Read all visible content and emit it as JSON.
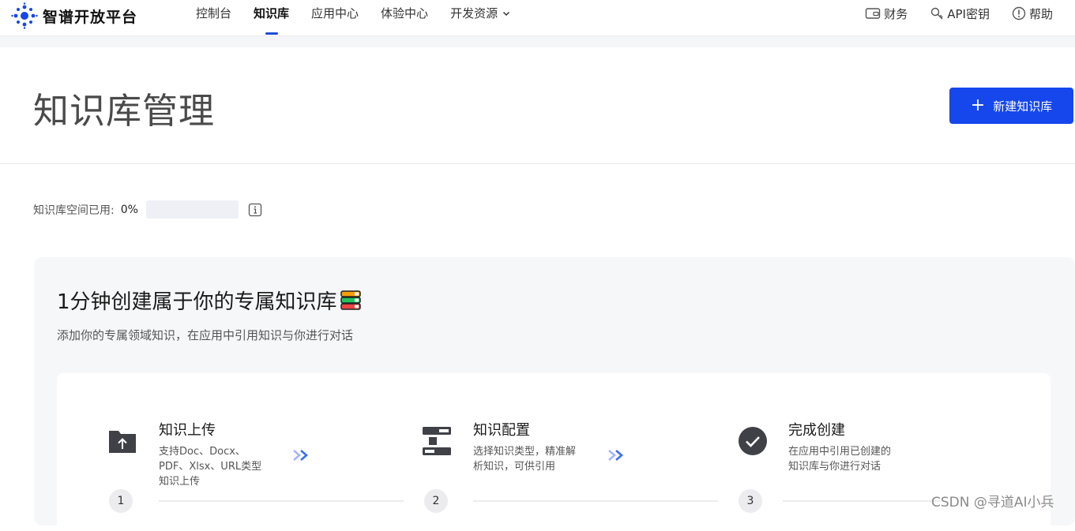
{
  "app": {
    "name": "智谱开放平台"
  },
  "nav": {
    "items": [
      {
        "label": "控制台",
        "active": false
      },
      {
        "label": "知识库",
        "active": true
      },
      {
        "label": "应用中心",
        "active": false
      },
      {
        "label": "体验中心",
        "active": false
      },
      {
        "label": "开发资源",
        "active": false,
        "has_dropdown": true
      }
    ],
    "right": [
      {
        "label": "财务",
        "icon": "wallet-icon"
      },
      {
        "label": "API密钥",
        "icon": "key-icon"
      },
      {
        "label": "帮助",
        "icon": "help-icon"
      }
    ]
  },
  "page": {
    "title": "知识库管理",
    "new_button_label": "新建知识库"
  },
  "usage": {
    "label": "知识库空间已用:",
    "value": "0%",
    "percent": 0
  },
  "intro": {
    "title": "1分钟创建属于你的专属知识库",
    "subtitle": "添加你的专属领域知识，在应用中引用知识与你进行对话",
    "steps": [
      {
        "number": "1",
        "title": "知识上传",
        "desc": "支持Doc、Docx、PDF、Xlsx、URL类型知识上传",
        "icon": "folder-upload-icon"
      },
      {
        "number": "2",
        "title": "知识配置",
        "desc": "选择知识类型，精准解析知识，可供引用",
        "icon": "config-icon"
      },
      {
        "number": "3",
        "title": "完成创建",
        "desc": "在应用中引用已创建的知识库与你进行对话",
        "icon": "check-circle-icon"
      }
    ]
  },
  "watermark": "CSDN @寻道AI小兵",
  "colors": {
    "primary": "#1547ed",
    "nav_active_underline": "#1d4ed8"
  }
}
